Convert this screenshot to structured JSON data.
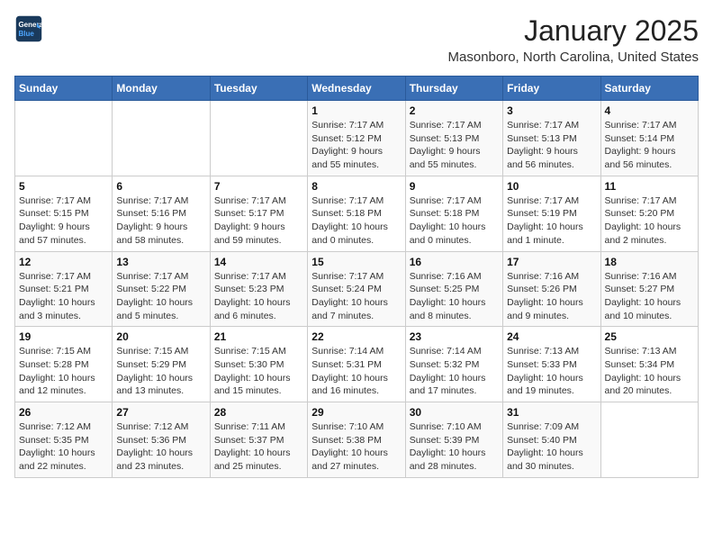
{
  "header": {
    "logo_line1": "General",
    "logo_line2": "Blue",
    "month": "January 2025",
    "location": "Masonboro, North Carolina, United States"
  },
  "days_of_week": [
    "Sunday",
    "Monday",
    "Tuesday",
    "Wednesday",
    "Thursday",
    "Friday",
    "Saturday"
  ],
  "weeks": [
    [
      {
        "num": "",
        "info": ""
      },
      {
        "num": "",
        "info": ""
      },
      {
        "num": "",
        "info": ""
      },
      {
        "num": "1",
        "info": "Sunrise: 7:17 AM\nSunset: 5:12 PM\nDaylight: 9 hours\nand 55 minutes."
      },
      {
        "num": "2",
        "info": "Sunrise: 7:17 AM\nSunset: 5:13 PM\nDaylight: 9 hours\nand 55 minutes."
      },
      {
        "num": "3",
        "info": "Sunrise: 7:17 AM\nSunset: 5:13 PM\nDaylight: 9 hours\nand 56 minutes."
      },
      {
        "num": "4",
        "info": "Sunrise: 7:17 AM\nSunset: 5:14 PM\nDaylight: 9 hours\nand 56 minutes."
      }
    ],
    [
      {
        "num": "5",
        "info": "Sunrise: 7:17 AM\nSunset: 5:15 PM\nDaylight: 9 hours\nand 57 minutes."
      },
      {
        "num": "6",
        "info": "Sunrise: 7:17 AM\nSunset: 5:16 PM\nDaylight: 9 hours\nand 58 minutes."
      },
      {
        "num": "7",
        "info": "Sunrise: 7:17 AM\nSunset: 5:17 PM\nDaylight: 9 hours\nand 59 minutes."
      },
      {
        "num": "8",
        "info": "Sunrise: 7:17 AM\nSunset: 5:18 PM\nDaylight: 10 hours\nand 0 minutes."
      },
      {
        "num": "9",
        "info": "Sunrise: 7:17 AM\nSunset: 5:18 PM\nDaylight: 10 hours\nand 0 minutes."
      },
      {
        "num": "10",
        "info": "Sunrise: 7:17 AM\nSunset: 5:19 PM\nDaylight: 10 hours\nand 1 minute."
      },
      {
        "num": "11",
        "info": "Sunrise: 7:17 AM\nSunset: 5:20 PM\nDaylight: 10 hours\nand 2 minutes."
      }
    ],
    [
      {
        "num": "12",
        "info": "Sunrise: 7:17 AM\nSunset: 5:21 PM\nDaylight: 10 hours\nand 3 minutes."
      },
      {
        "num": "13",
        "info": "Sunrise: 7:17 AM\nSunset: 5:22 PM\nDaylight: 10 hours\nand 5 minutes."
      },
      {
        "num": "14",
        "info": "Sunrise: 7:17 AM\nSunset: 5:23 PM\nDaylight: 10 hours\nand 6 minutes."
      },
      {
        "num": "15",
        "info": "Sunrise: 7:17 AM\nSunset: 5:24 PM\nDaylight: 10 hours\nand 7 minutes."
      },
      {
        "num": "16",
        "info": "Sunrise: 7:16 AM\nSunset: 5:25 PM\nDaylight: 10 hours\nand 8 minutes."
      },
      {
        "num": "17",
        "info": "Sunrise: 7:16 AM\nSunset: 5:26 PM\nDaylight: 10 hours\nand 9 minutes."
      },
      {
        "num": "18",
        "info": "Sunrise: 7:16 AM\nSunset: 5:27 PM\nDaylight: 10 hours\nand 10 minutes."
      }
    ],
    [
      {
        "num": "19",
        "info": "Sunrise: 7:15 AM\nSunset: 5:28 PM\nDaylight: 10 hours\nand 12 minutes."
      },
      {
        "num": "20",
        "info": "Sunrise: 7:15 AM\nSunset: 5:29 PM\nDaylight: 10 hours\nand 13 minutes."
      },
      {
        "num": "21",
        "info": "Sunrise: 7:15 AM\nSunset: 5:30 PM\nDaylight: 10 hours\nand 15 minutes."
      },
      {
        "num": "22",
        "info": "Sunrise: 7:14 AM\nSunset: 5:31 PM\nDaylight: 10 hours\nand 16 minutes."
      },
      {
        "num": "23",
        "info": "Sunrise: 7:14 AM\nSunset: 5:32 PM\nDaylight: 10 hours\nand 17 minutes."
      },
      {
        "num": "24",
        "info": "Sunrise: 7:13 AM\nSunset: 5:33 PM\nDaylight: 10 hours\nand 19 minutes."
      },
      {
        "num": "25",
        "info": "Sunrise: 7:13 AM\nSunset: 5:34 PM\nDaylight: 10 hours\nand 20 minutes."
      }
    ],
    [
      {
        "num": "26",
        "info": "Sunrise: 7:12 AM\nSunset: 5:35 PM\nDaylight: 10 hours\nand 22 minutes."
      },
      {
        "num": "27",
        "info": "Sunrise: 7:12 AM\nSunset: 5:36 PM\nDaylight: 10 hours\nand 23 minutes."
      },
      {
        "num": "28",
        "info": "Sunrise: 7:11 AM\nSunset: 5:37 PM\nDaylight: 10 hours\nand 25 minutes."
      },
      {
        "num": "29",
        "info": "Sunrise: 7:10 AM\nSunset: 5:38 PM\nDaylight: 10 hours\nand 27 minutes."
      },
      {
        "num": "30",
        "info": "Sunrise: 7:10 AM\nSunset: 5:39 PM\nDaylight: 10 hours\nand 28 minutes."
      },
      {
        "num": "31",
        "info": "Sunrise: 7:09 AM\nSunset: 5:40 PM\nDaylight: 10 hours\nand 30 minutes."
      },
      {
        "num": "",
        "info": ""
      }
    ]
  ]
}
